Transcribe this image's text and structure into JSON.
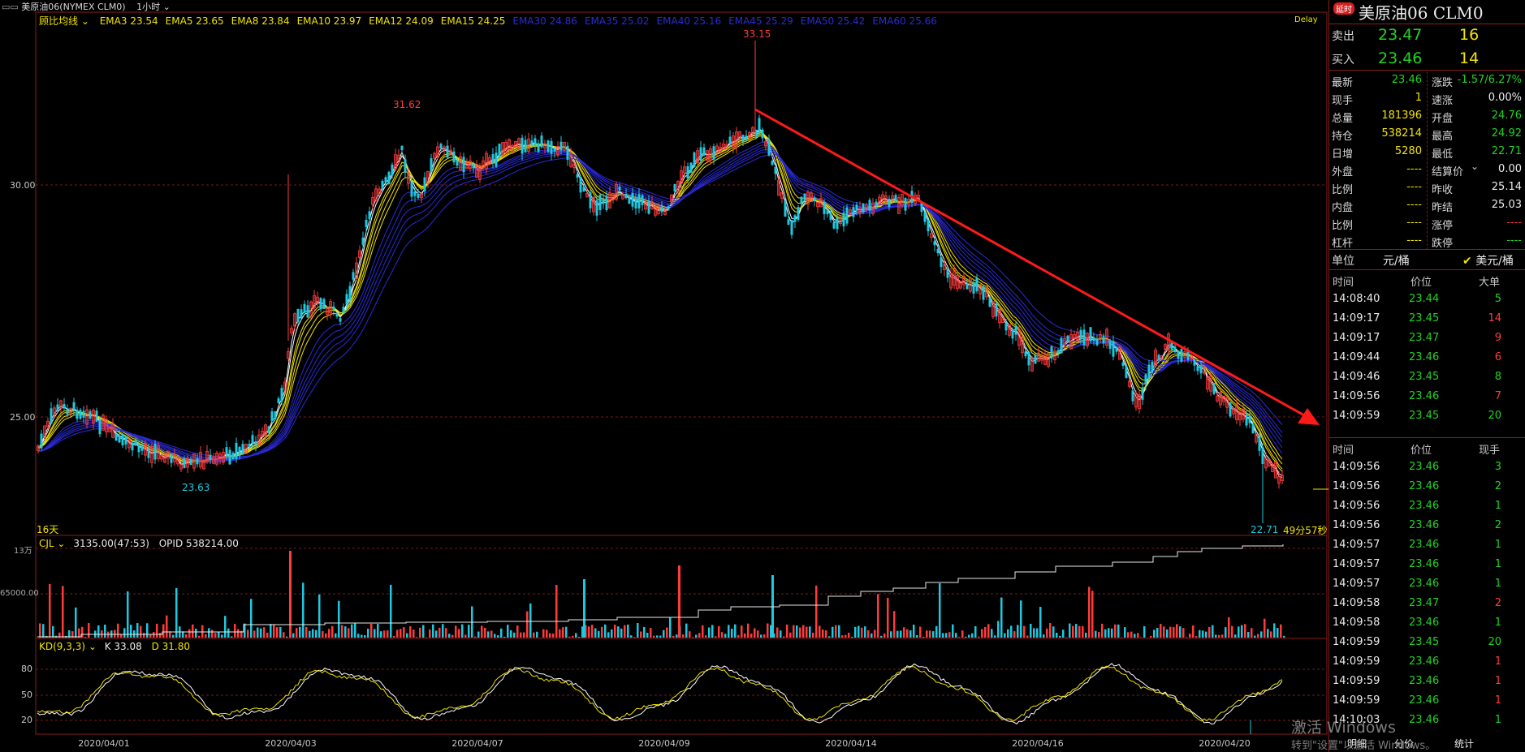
{
  "window": {
    "title": "美原油06(NYMEX CLM0)",
    "period": "1小时",
    "delay_badge": "Delay"
  },
  "indicator_bar": {
    "name": "顾比均线",
    "items": [
      {
        "label": "EMA3 23.54",
        "color": "#f2e300"
      },
      {
        "label": "EMA5 23.65",
        "color": "#f2e300"
      },
      {
        "label": "EMA8 23.84",
        "color": "#f2e300"
      },
      {
        "label": "EMA10 23.97",
        "color": "#f2e300"
      },
      {
        "label": "EMA12 24.09",
        "color": "#f2e300"
      },
      {
        "label": "EMA15 24.25",
        "color": "#f2e300"
      },
      {
        "label": "EMA30 24.86",
        "color": "#2a2ad8"
      },
      {
        "label": "EMA35 25.02",
        "color": "#2a2ad8"
      },
      {
        "label": "EMA40 25.16",
        "color": "#2a2ad8"
      },
      {
        "label": "EMA45 25.29",
        "color": "#2a2ad8"
      },
      {
        "label": "EMA50 25.42",
        "color": "#2a2ad8"
      },
      {
        "label": "EMA60 25.66",
        "color": "#2a2ad8"
      }
    ]
  },
  "price_chart": {
    "y_ticks": [
      "30.00",
      "25.00"
    ],
    "annotations": {
      "high_1": "31.62",
      "high_2": "33.15",
      "low_1": "23.63",
      "low_2": "22.71",
      "days": "16天",
      "countdown": "49分57秒"
    }
  },
  "volume_pane": {
    "header_name": "CJL",
    "header_value": "3135.00(47:53)",
    "header_opid": "OPID 538214.00",
    "y_ticks": [
      "13万",
      "65000.00"
    ]
  },
  "kd_pane": {
    "header_name": "KD(9,3,3)",
    "k_label": "K 33.08",
    "d_label": "D 31.80",
    "y_ticks": [
      "80",
      "50",
      "20"
    ]
  },
  "x_axis": {
    "labels": [
      "2020/04/01",
      "2020/04/03",
      "2020/04/07",
      "2020/04/09",
      "2020/04/14",
      "2020/04/16",
      "2020/04/20"
    ]
  },
  "side_panel": {
    "badge": "延时",
    "title": "美原油06",
    "code": "CLM0",
    "ask": {
      "label": "卖出",
      "price": "23.47",
      "qty": "16"
    },
    "bid": {
      "label": "买入",
      "price": "23.46",
      "qty": "14"
    },
    "quote_left": [
      {
        "label": "最新",
        "value": "23.46",
        "color": "#21d321"
      },
      {
        "label": "现手",
        "value": "1",
        "color": "#f2e300"
      },
      {
        "label": "总量",
        "value": "181396",
        "color": "#f2e300"
      },
      {
        "label": "持仓",
        "value": "538214",
        "color": "#f2e300"
      },
      {
        "label": "日增",
        "value": "5280",
        "color": "#f2e300"
      },
      {
        "label": "外盘",
        "value": "----",
        "color": "#f2e300"
      },
      {
        "label": "比例",
        "value": "----",
        "color": "#f2e300"
      },
      {
        "label": "内盘",
        "value": "----",
        "color": "#f2e300"
      },
      {
        "label": "比例",
        "value": "----",
        "color": "#f2e300"
      },
      {
        "label": "杠杆",
        "value": "----",
        "color": "#f2e300"
      }
    ],
    "quote_right": [
      {
        "label": "涨跌",
        "value": "-1.57/6.27%",
        "color": "#21d321"
      },
      {
        "label": "速涨",
        "value": "0.00%",
        "color": "#ececec"
      },
      {
        "label": "开盘",
        "value": "24.76",
        "color": "#21d321"
      },
      {
        "label": "最高",
        "value": "24.92",
        "color": "#21d321"
      },
      {
        "label": "最低",
        "value": "22.71",
        "color": "#21d321"
      },
      {
        "label": "结算价",
        "value": "0.00",
        "color": "#ececec"
      },
      {
        "label": "昨收",
        "value": "25.14",
        "color": "#ececec"
      },
      {
        "label": "昨结",
        "value": "25.03",
        "color": "#ececec"
      },
      {
        "label": "涨停",
        "value": "----",
        "color": "#ff3b3b"
      },
      {
        "label": "跌停",
        "value": "----",
        "color": "#21d321"
      }
    ],
    "unit": {
      "label": "单位",
      "opt1": "元/桶",
      "opt2": "美元/桶"
    },
    "big_orders": {
      "headers": [
        "时间",
        "价位",
        "大单"
      ],
      "rows": [
        {
          "time": "14:08:40",
          "price": "23.44",
          "qty": "5",
          "qty_color": "#21d321"
        },
        {
          "time": "14:09:17",
          "price": "23.45",
          "qty": "14",
          "qty_color": "#ff3b3b"
        },
        {
          "time": "14:09:17",
          "price": "23.47",
          "qty": "9",
          "qty_color": "#ff3b3b"
        },
        {
          "time": "14:09:44",
          "price": "23.46",
          "qty": "6",
          "qty_color": "#ff3b3b"
        },
        {
          "time": "14:09:46",
          "price": "23.45",
          "qty": "8",
          "qty_color": "#21d321"
        },
        {
          "time": "14:09:56",
          "price": "23.46",
          "qty": "7",
          "qty_color": "#ff3b3b"
        },
        {
          "time": "14:09:59",
          "price": "23.45",
          "qty": "20",
          "qty_color": "#21d321"
        }
      ]
    },
    "ticks": {
      "headers": [
        "时间",
        "价位",
        "现手"
      ],
      "rows": [
        {
          "time": "14:09:56",
          "price": "23.46",
          "qty": "3",
          "qty_color": "#21d321"
        },
        {
          "time": "14:09:56",
          "price": "23.46",
          "qty": "2",
          "qty_color": "#21d321"
        },
        {
          "time": "14:09:56",
          "price": "23.46",
          "qty": "1",
          "qty_color": "#21d321"
        },
        {
          "time": "14:09:56",
          "price": "23.46",
          "qty": "2",
          "qty_color": "#21d321"
        },
        {
          "time": "14:09:57",
          "price": "23.46",
          "qty": "1",
          "qty_color": "#21d321"
        },
        {
          "time": "14:09:57",
          "price": "23.46",
          "qty": "1",
          "qty_color": "#21d321"
        },
        {
          "time": "14:09:57",
          "price": "23.46",
          "qty": "1",
          "qty_color": "#21d321"
        },
        {
          "time": "14:09:58",
          "price": "23.47",
          "qty": "2",
          "qty_color": "#ff3b3b"
        },
        {
          "time": "14:09:58",
          "price": "23.46",
          "qty": "1",
          "qty_color": "#21d321"
        },
        {
          "time": "14:09:59",
          "price": "23.45",
          "qty": "20",
          "qty_color": "#21d321"
        },
        {
          "time": "14:09:59",
          "price": "23.46",
          "qty": "1",
          "qty_color": "#ff3b3b"
        },
        {
          "time": "14:09:59",
          "price": "23.46",
          "qty": "1",
          "qty_color": "#ff3b3b"
        },
        {
          "time": "14:09:59",
          "price": "23.46",
          "qty": "1",
          "qty_color": "#ff3b3b"
        },
        {
          "time": "14:10:03",
          "price": "23.46",
          "qty": "1",
          "qty_color": "#21d321"
        }
      ]
    },
    "bottom_tabs": [
      "明细",
      "分价",
      "统计"
    ]
  },
  "watermark": {
    "line1": "激活 Windows",
    "line2": "转到\"设置\"以激活 Windows。"
  }
}
